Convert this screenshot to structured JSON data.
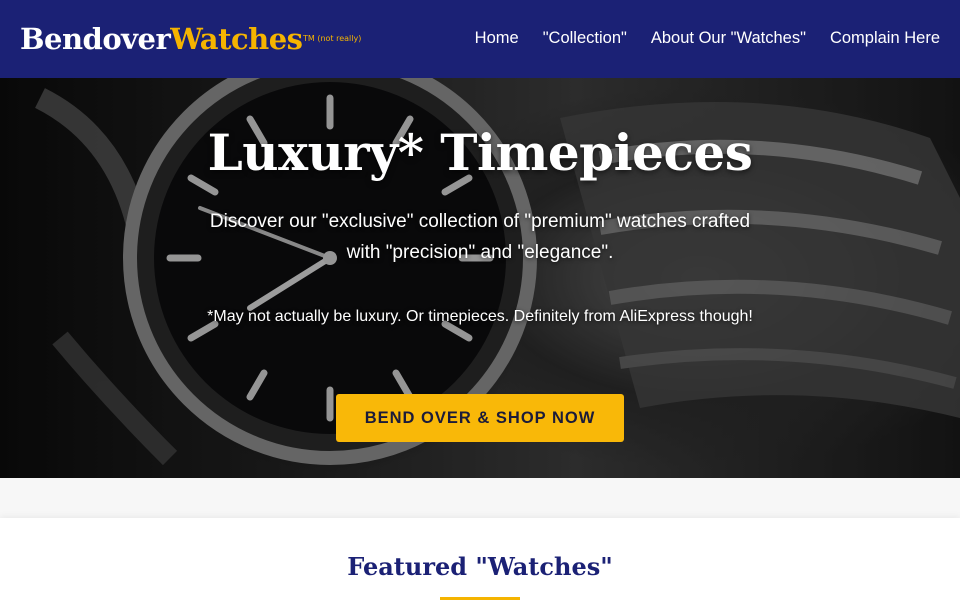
{
  "navbar": {
    "logo_part1": "Bendover",
    "logo_part2": "Watches",
    "tm_note": "TM (not really)",
    "links": [
      "Home",
      "\"Collection\"",
      "About Our \"Watches\"",
      "Complain Here"
    ]
  },
  "hero": {
    "title": "Luxury* Timepieces",
    "subtitle": "Discover our \"exclusive\" collection of \"premium\" watches crafted with \"precision\" and \"elegance\".",
    "disclaimer": "*May not actually be luxury. Or timepieces. Definitely from AliExpress though!",
    "cta_label": "BEND OVER & SHOP NOW",
    "image_icon": "wristwatch-photo"
  },
  "featured": {
    "title": "Featured \"Watches\""
  },
  "colors": {
    "navy": "#1b2175",
    "gold": "#f5b400",
    "cta": "#f9b808"
  }
}
